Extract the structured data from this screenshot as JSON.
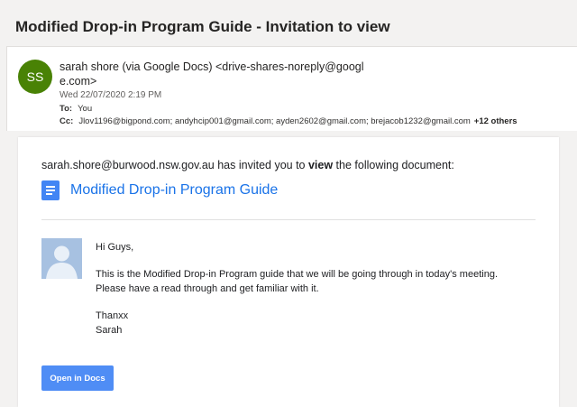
{
  "email": {
    "subject": "Modified Drop-in Program Guide - Invitation to view",
    "avatar_initials": "SS",
    "from": "sarah shore (via Google Docs) <drive-shares-noreply@google.com>",
    "date": "Wed 22/07/2020 2:19 PM",
    "to_label": "To:",
    "to": "You",
    "cc_label": "Cc:",
    "cc": "Jlov1196@bigpond.com; andyhcip001@gmail.com; ayden2602@gmail.com; brejacob1232@gmail.com",
    "cc_more": "+12 others"
  },
  "body": {
    "invite_prefix": "sarah.shore@burwood.nsw.gov.au has invited you to ",
    "invite_verb": "view",
    "invite_suffix": " the following document:",
    "doc_title": "Modified Drop-in Program Guide",
    "greeting": "Hi Guys,",
    "paragraph": "This is the Modified Drop-in Program guide that we will be going through in today's meeting. Please have a read through and get familiar with it.",
    "signoff": "Thanxx",
    "signature": "Sarah",
    "open_button": "Open in Docs"
  },
  "colors": {
    "avatar": "#498205",
    "doc_icon": "#4285f4",
    "link": "#1a73e8",
    "button": "#4f8df5"
  },
  "icons": {
    "doc": "google-docs-icon",
    "profile": "default-profile-icon"
  }
}
